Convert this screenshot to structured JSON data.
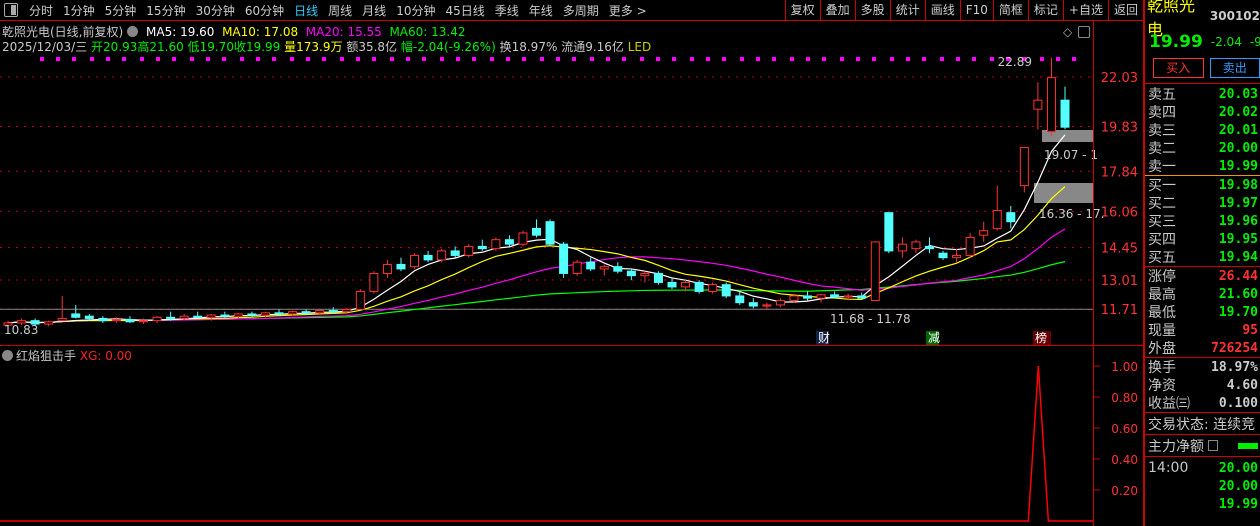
{
  "toolbar": {
    "periods": [
      "分时",
      "1分钟",
      "5分钟",
      "15分钟",
      "30分钟",
      "60分钟",
      "日线",
      "周线",
      "月线",
      "10分钟",
      "45日线",
      "季线",
      "年线",
      "多周期",
      "更多 >"
    ],
    "active": "日线",
    "tools": [
      "复权",
      "叠加",
      "多股",
      "统计",
      "画线",
      "F10",
      "简框",
      "标记",
      "+自选",
      "返回"
    ]
  },
  "info": {
    "title": "乾照光电(日线,前复权)",
    "ma5": "MA5: 19.60",
    "ma10": "MA10: 17.08",
    "ma20": "MA20: 15.55",
    "ma60": "MA60: 13.42",
    "date": "2025/12/03/三",
    "open": "开20.93",
    "high": "高21.60",
    "low": "低19.70",
    "close": "收19.99",
    "vol": "量173.9万",
    "amount": "额35.8亿",
    "change": "幅-2.04(-9.26%)",
    "turnover": "换18.97%",
    "float": "流通9.16亿",
    "sector": "LED"
  },
  "colors": {
    "up": "#ff3232",
    "down": "#54ffff",
    "ma5": "#ffffff",
    "ma10": "#ffff00",
    "ma20": "#ff00ff",
    "ma60": "#00ff00",
    "grid": "#c00000"
  },
  "chart_data": {
    "type": "candlestick",
    "y_ticks": [
      "22.03",
      "19.83",
      "17.84",
      "16.06",
      "14.45",
      "13.01",
      "11.71"
    ],
    "annotations": {
      "max": "22.89",
      "min_left": "10.83",
      "zone_low": "11.68 - 11.78",
      "zone_mid": "16.36 - 17.",
      "zone_high": "19.07 - 1"
    },
    "events": [
      "财",
      "减",
      "榜"
    ],
    "ohlc": [
      [
        11.0,
        11.2,
        10.83,
        11.1
      ],
      [
        11.1,
        11.3,
        11.0,
        11.2
      ],
      [
        11.2,
        11.3,
        11.0,
        11.05
      ],
      [
        11.05,
        11.2,
        10.95,
        11.15
      ],
      [
        11.2,
        12.3,
        11.2,
        11.3
      ],
      [
        11.5,
        11.9,
        11.3,
        11.35
      ],
      [
        11.4,
        11.5,
        11.2,
        11.3
      ],
      [
        11.3,
        11.4,
        11.1,
        11.2
      ],
      [
        11.2,
        11.35,
        11.1,
        11.25
      ],
      [
        11.25,
        11.4,
        11.1,
        11.15
      ],
      [
        11.15,
        11.3,
        11.05,
        11.2
      ],
      [
        11.2,
        11.4,
        11.1,
        11.35
      ],
      [
        11.35,
        11.6,
        11.2,
        11.3
      ],
      [
        11.3,
        11.5,
        11.2,
        11.4
      ],
      [
        11.4,
        11.6,
        11.3,
        11.35
      ],
      [
        11.35,
        11.5,
        11.2,
        11.45
      ],
      [
        11.45,
        11.6,
        11.3,
        11.4
      ],
      [
        11.4,
        11.55,
        11.3,
        11.5
      ],
      [
        11.5,
        11.6,
        11.35,
        11.45
      ],
      [
        11.45,
        11.6,
        11.35,
        11.55
      ],
      [
        11.55,
        11.7,
        11.4,
        11.5
      ],
      [
        11.5,
        11.65,
        11.4,
        11.6
      ],
      [
        11.6,
        11.7,
        11.45,
        11.55
      ],
      [
        11.55,
        11.7,
        11.45,
        11.65
      ],
      [
        11.65,
        11.8,
        11.5,
        11.6
      ],
      [
        11.6,
        11.75,
        11.5,
        11.7
      ],
      [
        11.7,
        12.6,
        11.7,
        12.5
      ],
      [
        12.5,
        13.4,
        12.4,
        13.3
      ],
      [
        13.3,
        13.9,
        13.1,
        13.7
      ],
      [
        13.7,
        14.0,
        13.4,
        13.5
      ],
      [
        13.6,
        14.2,
        13.5,
        14.1
      ],
      [
        14.1,
        14.3,
        13.8,
        13.9
      ],
      [
        13.9,
        14.4,
        13.8,
        14.3
      ],
      [
        14.3,
        14.5,
        14.0,
        14.1
      ],
      [
        14.1,
        14.6,
        14.0,
        14.5
      ],
      [
        14.5,
        14.8,
        14.3,
        14.4
      ],
      [
        14.4,
        14.9,
        14.3,
        14.8
      ],
      [
        14.8,
        15.0,
        14.5,
        14.6
      ],
      [
        14.6,
        15.2,
        14.5,
        15.1
      ],
      [
        15.3,
        15.7,
        14.9,
        15.0
      ],
      [
        15.6,
        15.7,
        14.5,
        14.6
      ],
      [
        14.6,
        14.7,
        13.1,
        13.3
      ],
      [
        13.3,
        13.9,
        13.2,
        13.8
      ],
      [
        13.8,
        14.0,
        13.4,
        13.5
      ],
      [
        13.5,
        13.7,
        13.2,
        13.6
      ],
      [
        13.6,
        13.8,
        13.3,
        13.4
      ],
      [
        13.4,
        13.5,
        13.0,
        13.2
      ],
      [
        13.2,
        13.4,
        12.9,
        13.3
      ],
      [
        13.3,
        13.4,
        12.8,
        12.9
      ],
      [
        12.9,
        13.1,
        12.6,
        12.7
      ],
      [
        12.7,
        13.0,
        12.5,
        12.9
      ],
      [
        12.9,
        13.0,
        12.4,
        12.5
      ],
      [
        12.5,
        12.9,
        12.4,
        12.8
      ],
      [
        12.8,
        12.9,
        12.2,
        12.3
      ],
      [
        12.3,
        12.5,
        11.9,
        12.0
      ],
      [
        12.0,
        12.2,
        11.75,
        11.85
      ],
      [
        11.85,
        12.0,
        11.68,
        11.9
      ],
      [
        11.9,
        12.2,
        11.8,
        12.1
      ],
      [
        12.1,
        12.4,
        12.0,
        12.3
      ],
      [
        12.3,
        12.5,
        12.1,
        12.2
      ],
      [
        12.2,
        12.4,
        12.0,
        12.35
      ],
      [
        12.35,
        12.5,
        12.2,
        12.25
      ],
      [
        12.25,
        12.4,
        12.1,
        12.3
      ],
      [
        12.3,
        12.45,
        12.15,
        12.2
      ],
      [
        12.1,
        14.7,
        12.1,
        14.7
      ],
      [
        16.0,
        16.0,
        14.2,
        14.3
      ],
      [
        14.3,
        14.9,
        14.0,
        14.6
      ],
      [
        14.4,
        14.8,
        14.2,
        14.7
      ],
      [
        14.5,
        14.9,
        14.2,
        14.4
      ],
      [
        14.2,
        14.3,
        13.9,
        14.0
      ],
      [
        14.0,
        14.4,
        13.8,
        14.1
      ],
      [
        14.1,
        15.1,
        14.0,
        14.9
      ],
      [
        15.0,
        15.6,
        14.7,
        15.2
      ],
      [
        15.3,
        17.2,
        15.2,
        16.1
      ],
      [
        16.0,
        16.3,
        15.3,
        15.6
      ],
      [
        17.2,
        18.9,
        16.9,
        18.9
      ],
      [
        20.6,
        21.8,
        19.7,
        21.0
      ],
      [
        19.6,
        22.89,
        19.4,
        22.0
      ],
      [
        21.0,
        21.6,
        19.7,
        19.8
      ]
    ],
    "indicator": {
      "name": "红焰狙击手",
      "value_label": "XG: 0.00",
      "y_ticks": [
        "1.00",
        "0.80",
        "0.60",
        "0.40",
        "0.20"
      ],
      "signal_index": 75
    }
  },
  "quote": {
    "name": "乾照光电",
    "code": "300102",
    "price": "19.99",
    "change": "-2.04",
    "pct": "-9.",
    "buy_label": "买入",
    "sell_label": "卖出",
    "asks": [
      {
        "label": "卖五",
        "price": "20.03"
      },
      {
        "label": "卖四",
        "price": "20.02"
      },
      {
        "label": "卖三",
        "price": "20.01"
      },
      {
        "label": "卖二",
        "price": "20.00"
      },
      {
        "label": "卖一",
        "price": "19.99"
      }
    ],
    "bids": [
      {
        "label": "买一",
        "price": "19.98"
      },
      {
        "label": "买二",
        "price": "19.97"
      },
      {
        "label": "买三",
        "price": "19.96"
      },
      {
        "label": "买四",
        "price": "19.95"
      },
      {
        "label": "买五",
        "price": "19.94"
      }
    ],
    "stats1": [
      {
        "label": "涨停",
        "value": "26.44",
        "color": "#ff3232"
      },
      {
        "label": "最高",
        "value": "21.60",
        "color": "#0e0"
      },
      {
        "label": "最低",
        "value": "19.70",
        "color": "#0e0"
      },
      {
        "label": "现量",
        "value": "95",
        "color": "#ff3232"
      },
      {
        "label": "外盘",
        "value": "726254",
        "color": "#ff3232"
      }
    ],
    "stats2": [
      {
        "label": "换手",
        "value": "18.97%"
      },
      {
        "label": "净资",
        "value": "4.60"
      },
      {
        "label": "收益㈢",
        "value": "0.100"
      }
    ],
    "status": "交易状态: 连续竞",
    "main_flow": "主力净额",
    "ticks": [
      {
        "time": "14:00",
        "price": "20.00"
      },
      {
        "time": "",
        "price": "20.00"
      },
      {
        "time": "",
        "price": "19.99"
      }
    ]
  }
}
